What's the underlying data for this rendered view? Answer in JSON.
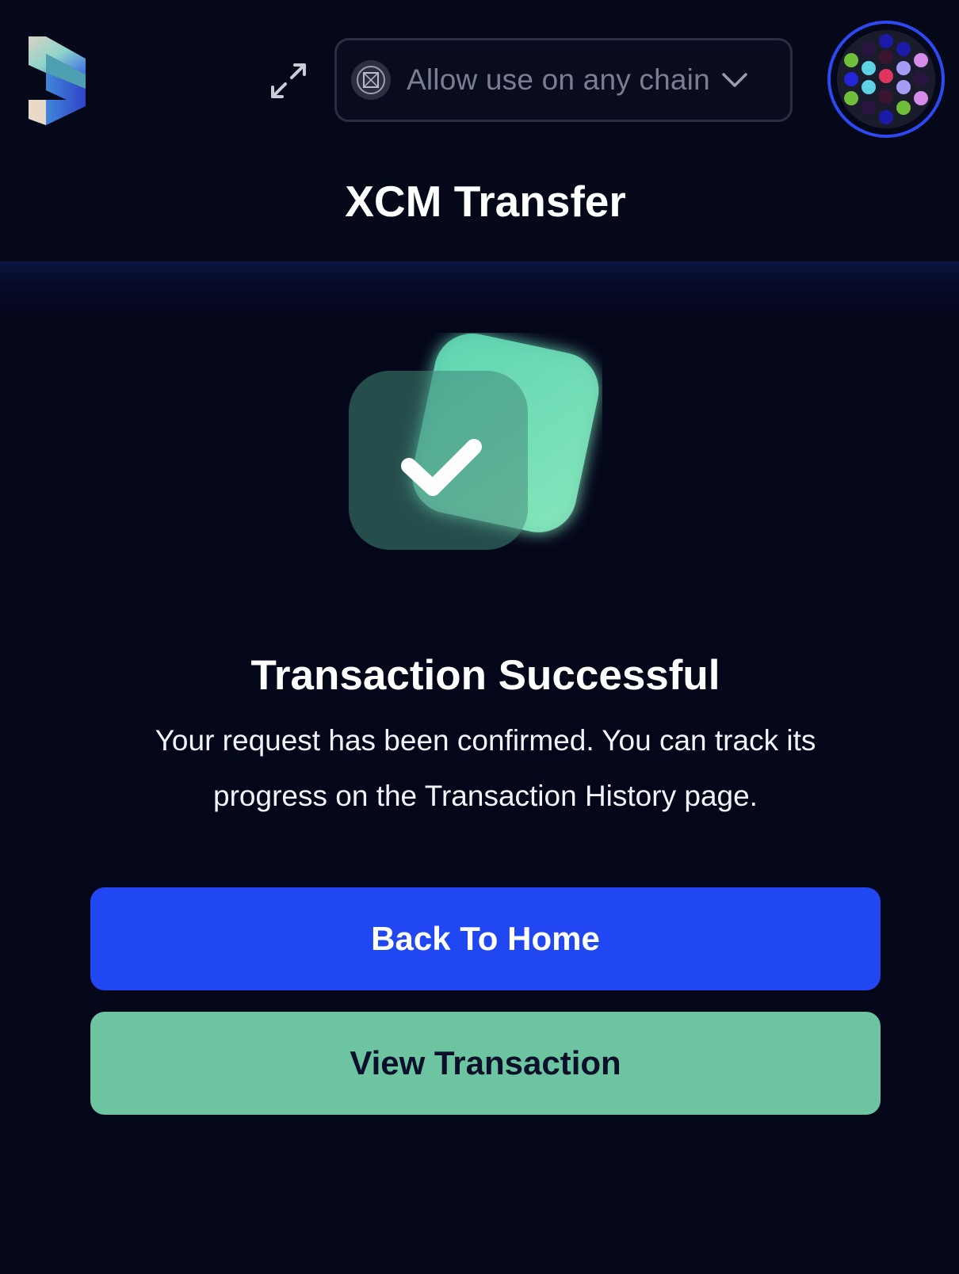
{
  "header": {
    "logo_icon": "app-logo-icon",
    "expand_icon": "expand-arrows-icon",
    "chain_selector": {
      "icon": "chain-network-icon",
      "label": "Allow use on any chain",
      "chevron_icon": "chevron-down-icon"
    },
    "avatar_icon": "account-identicon"
  },
  "page": {
    "title": "XCM Transfer"
  },
  "result": {
    "icon": "success-check-icon",
    "title": "Transaction Successful",
    "message": "Your request has been confirmed. You can track its progress on the Transaction History page."
  },
  "actions": {
    "primary_label": "Back To Home",
    "secondary_label": "View Transaction"
  },
  "colors": {
    "background": "#04061a",
    "primary_button": "#2147f2",
    "secondary_button": "#6dc4a0",
    "accent_green": "#6fe0b2",
    "avatar_ring": "#2c49f2"
  }
}
